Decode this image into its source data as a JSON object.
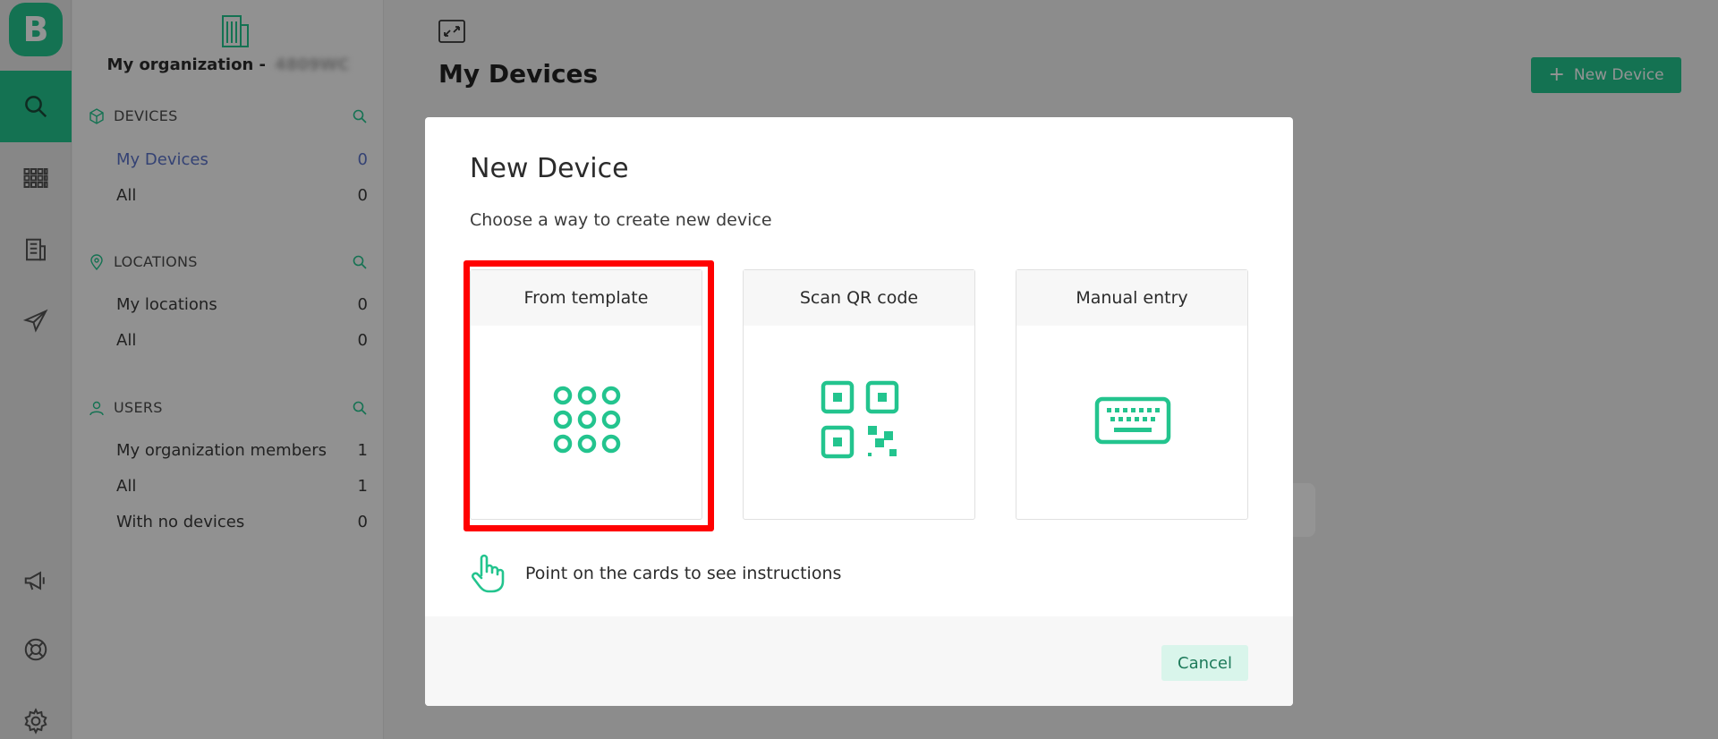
{
  "app": {
    "logo_letter": "B"
  },
  "rail": {
    "items": [
      {
        "icon": "search-icon",
        "active": true
      },
      {
        "icon": "grid-icon",
        "active": false
      },
      {
        "icon": "building-icon",
        "active": false
      },
      {
        "icon": "send-icon",
        "active": false
      },
      {
        "icon": "megaphone-icon",
        "active": false
      },
      {
        "icon": "lifebuoy-icon",
        "active": false
      },
      {
        "icon": "gear-icon",
        "active": false
      }
    ]
  },
  "sidebar": {
    "org_name": "My organization - ",
    "org_id_blurred": "4809WC",
    "devices": {
      "heading": "DEVICES",
      "items": [
        {
          "label": "My Devices",
          "count": "0"
        },
        {
          "label": "All",
          "count": "0"
        }
      ]
    },
    "locations": {
      "heading": "LOCATIONS",
      "items": [
        {
          "label": "My locations",
          "count": "0"
        },
        {
          "label": "All",
          "count": "0"
        }
      ]
    },
    "users": {
      "heading": "USERS",
      "items": [
        {
          "label": "My organization members",
          "count": "1"
        },
        {
          "label": "All",
          "count": "1"
        },
        {
          "label": "With no devices",
          "count": "0"
        }
      ]
    }
  },
  "main": {
    "title": "My Devices",
    "new_device_label": "New Device",
    "new_device_plus": "+"
  },
  "modal": {
    "title": "New Device",
    "subtitle": "Choose a way to create new device",
    "cards": [
      {
        "label": "From template",
        "icon": "template-grid-icon"
      },
      {
        "label": "Scan QR code",
        "icon": "qr-code-icon"
      },
      {
        "label": "Manual entry",
        "icon": "keyboard-icon"
      }
    ],
    "hint": "Point on the cards to see instructions",
    "cancel_label": "Cancel"
  },
  "colors": {
    "accent": "#23c48e",
    "highlight": "#ff0000",
    "active_link": "#5b72c8"
  }
}
